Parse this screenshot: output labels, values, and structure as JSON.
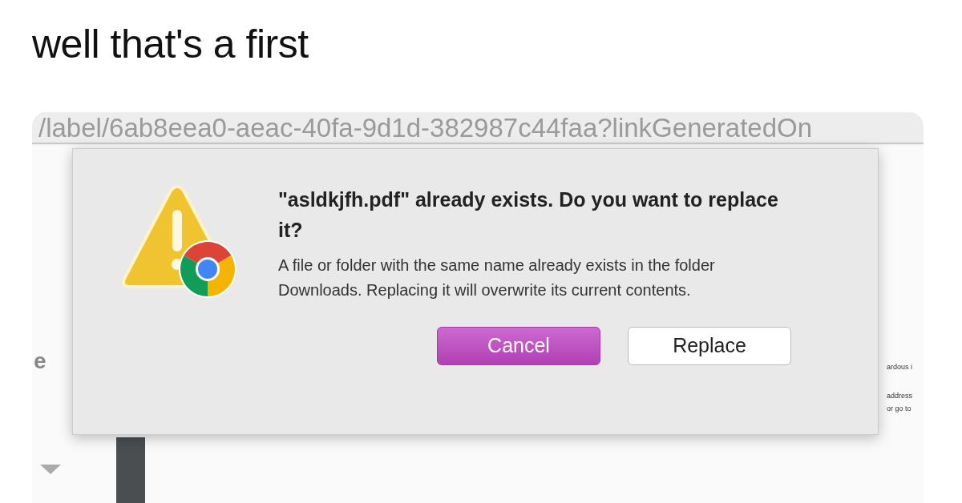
{
  "caption": "well that's a first",
  "address_bar": {
    "text": "/label/6ab8eea0-aeac-40fa-9d1d-382987c44faa?linkGeneratedOn"
  },
  "background_page": {
    "left_text": "e",
    "right_texts": [
      "ardous i",
      "address",
      "or go to"
    ]
  },
  "dialog": {
    "title": "\"asldkjfh.pdf\" already exists. Do you want to replace it?",
    "message": "A file or folder with the same name already exists in the folder Downloads. Replacing it will overwrite its current contents.",
    "buttons": [
      {
        "label": "Cancel",
        "default": true
      },
      {
        "label": "Replace",
        "default": false
      }
    ]
  }
}
